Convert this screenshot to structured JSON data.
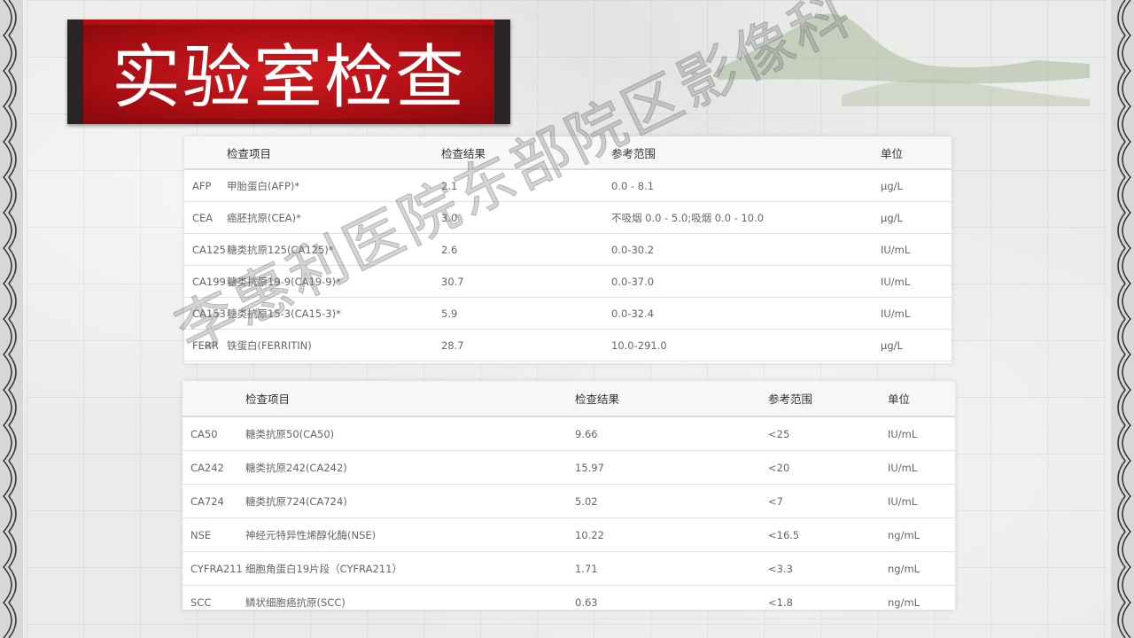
{
  "title": "实验室检查",
  "watermark": "李惠利医院东部院区影像科",
  "table1": {
    "headers": [
      "",
      "检查项目",
      "检查结果",
      "参考范围",
      "单位"
    ],
    "rows": [
      {
        "code": "AFP",
        "name": "甲胎蛋白(AFP)*",
        "result": "2.1",
        "range": "0.0 - 8.1",
        "unit": "μg/L"
      },
      {
        "code": "CEA",
        "name": "癌胚抗原(CEA)*",
        "result": "3.0",
        "range": "不吸烟 0.0 - 5.0;吸烟 0.0 - 10.0",
        "unit": "μg/L"
      },
      {
        "code": "CA125",
        "name": "糖类抗原125(CA125)*",
        "result": "2.6",
        "range": "0.0-30.2",
        "unit": "IU/mL"
      },
      {
        "code": "CA199",
        "name": "糖类抗原19-9(CA19-9)*",
        "result": "30.7",
        "range": "0.0-37.0",
        "unit": "IU/mL"
      },
      {
        "code": "CA153",
        "name": "糖类抗原15-3(CA15-3)*",
        "result": "5.9",
        "range": "0.0-32.4",
        "unit": "IU/mL"
      },
      {
        "code": "FERR",
        "name": "铁蛋白(FERRITIN)",
        "result": "28.7",
        "range": "10.0-291.0",
        "unit": "μg/L"
      }
    ]
  },
  "table2": {
    "headers": [
      "",
      "检查项目",
      "检查结果",
      "参考范围",
      "单位"
    ],
    "rows": [
      {
        "code": "CA50",
        "name": "糖类抗原50(CA50)",
        "result": "9.66",
        "range": "<25",
        "unit": "IU/mL"
      },
      {
        "code": "CA242",
        "name": "糖类抗原242(CA242)",
        "result": "15.97",
        "range": "<20",
        "unit": "IU/mL"
      },
      {
        "code": "CA724",
        "name": "糖类抗原724(CA724)",
        "result": "5.02",
        "range": "<7",
        "unit": "IU/mL"
      },
      {
        "code": "NSE",
        "name": "神经元特异性烯醇化酶(NSE)",
        "result": "10.22",
        "range": "<16.5",
        "unit": "ng/mL"
      },
      {
        "code": "CYFRA211",
        "name": "细胞角蛋白19片段（CYFRA211）",
        "result": "1.71",
        "range": "<3.3",
        "unit": "ng/mL"
      },
      {
        "code": "SCC",
        "name": "鳞状细胞癌抗原(SCC)",
        "result": "0.63",
        "range": "<1.8",
        "unit": "ng/mL"
      }
    ]
  }
}
